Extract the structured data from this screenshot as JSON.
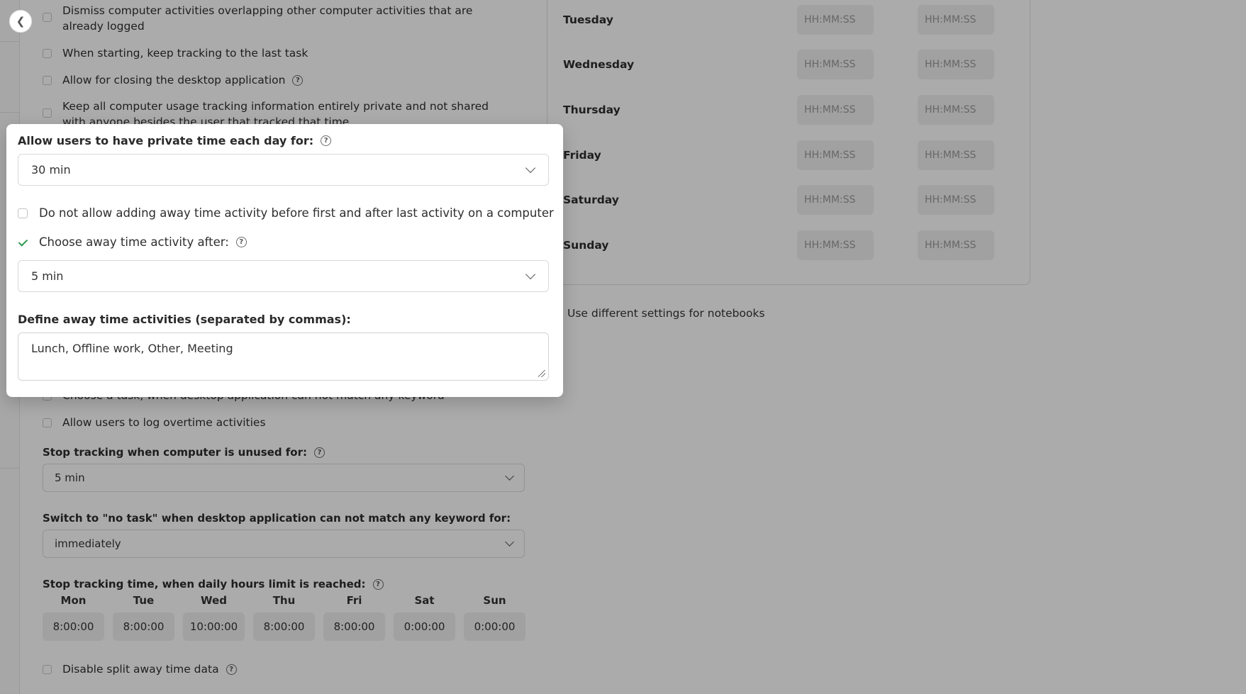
{
  "background": {
    "settings": {
      "dismiss_overlapping": "Dismiss computer activities overlapping other computer activities that are already logged",
      "keep_last_task": "When starting, keep tracking to the last task",
      "allow_closing": "Allow for closing the desktop application",
      "keep_private": "Keep all computer usage tracking information entirely private and not shared with anyone besides the user that tracked that time",
      "choose_task_partial": "Choose a task, when desktop application can not match any keyword",
      "allow_overtime": "Allow users to log overtime activities",
      "stop_unused_label": "Stop tracking when computer is unused for:",
      "stop_unused_value": "5 min",
      "switch_no_task_label": "Switch to \"no task\" when desktop application can not match any keyword for:",
      "switch_no_task_value": "immediately",
      "daily_limit_label": "Stop tracking time, when daily hours limit is reached:",
      "daily_limits": [
        {
          "day": "Mon",
          "value": "8:00:00"
        },
        {
          "day": "Tue",
          "value": "8:00:00"
        },
        {
          "day": "Wed",
          "value": "10:00:00"
        },
        {
          "day": "Thu",
          "value": "8:00:00"
        },
        {
          "day": "Fri",
          "value": "8:00:00"
        },
        {
          "day": "Sat",
          "value": "0:00:00"
        },
        {
          "day": "Sun",
          "value": "0:00:00"
        }
      ],
      "disable_split": "Disable split away time data"
    },
    "schedule": {
      "days": [
        "Tuesday",
        "Wednesday",
        "Thursday",
        "Friday",
        "Saturday",
        "Sunday"
      ],
      "placeholder": "HH:MM:SS"
    },
    "notebooks_label": "Use different settings for notebooks"
  },
  "popover": {
    "private_time_label": "Allow users to have private time each day for:",
    "private_time_value": "30 min",
    "no_away_before_after": "Do not allow adding away time activity before first and after last activity on a computer",
    "choose_away_after_label": "Choose away time activity after:",
    "choose_away_after_value": "5 min",
    "define_away_label": "Define away time activities (separated by commas):",
    "away_activities": "Lunch, Offline work, Other, Meeting"
  },
  "colors": {
    "check_green": "#2e9a4f",
    "overlay": "rgba(0,0,0,0.33)"
  }
}
